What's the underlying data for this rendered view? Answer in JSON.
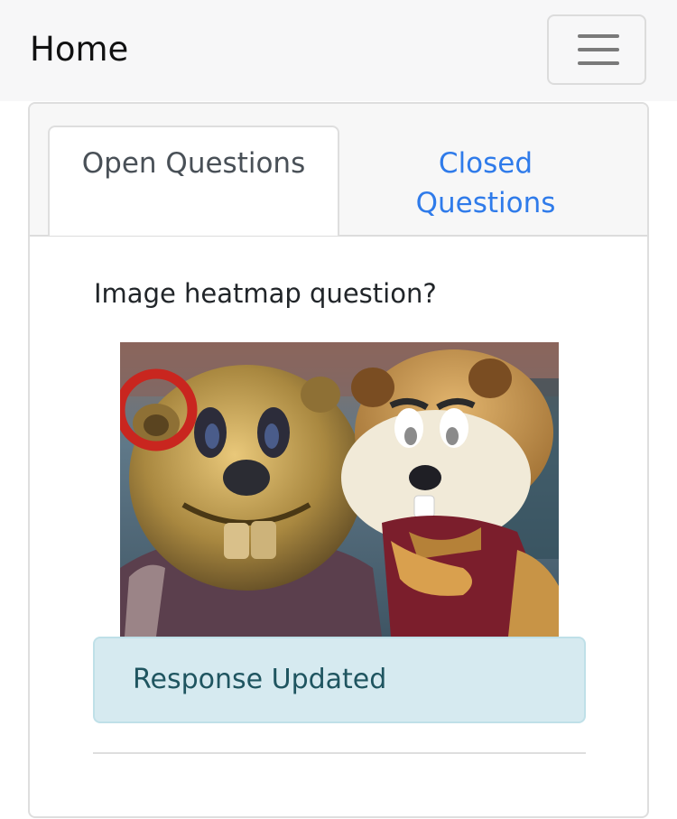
{
  "navbar": {
    "brand": "Home",
    "menu_icon": "hamburger-menu-icon"
  },
  "tabs": [
    {
      "label": "Open Questions",
      "active": true
    },
    {
      "label": "Closed Questions",
      "active": false
    }
  ],
  "question": {
    "text": "Image heatmap question?",
    "image_alt": "Goldy Gopher mascot posing beside a bronze gopher statue",
    "marker_color": "#c9261f"
  },
  "alert": {
    "text": "Response Updated"
  },
  "colors": {
    "link": "#2f7bea",
    "alert_bg": "#d6eaf0",
    "alert_text": "#1f5560"
  }
}
